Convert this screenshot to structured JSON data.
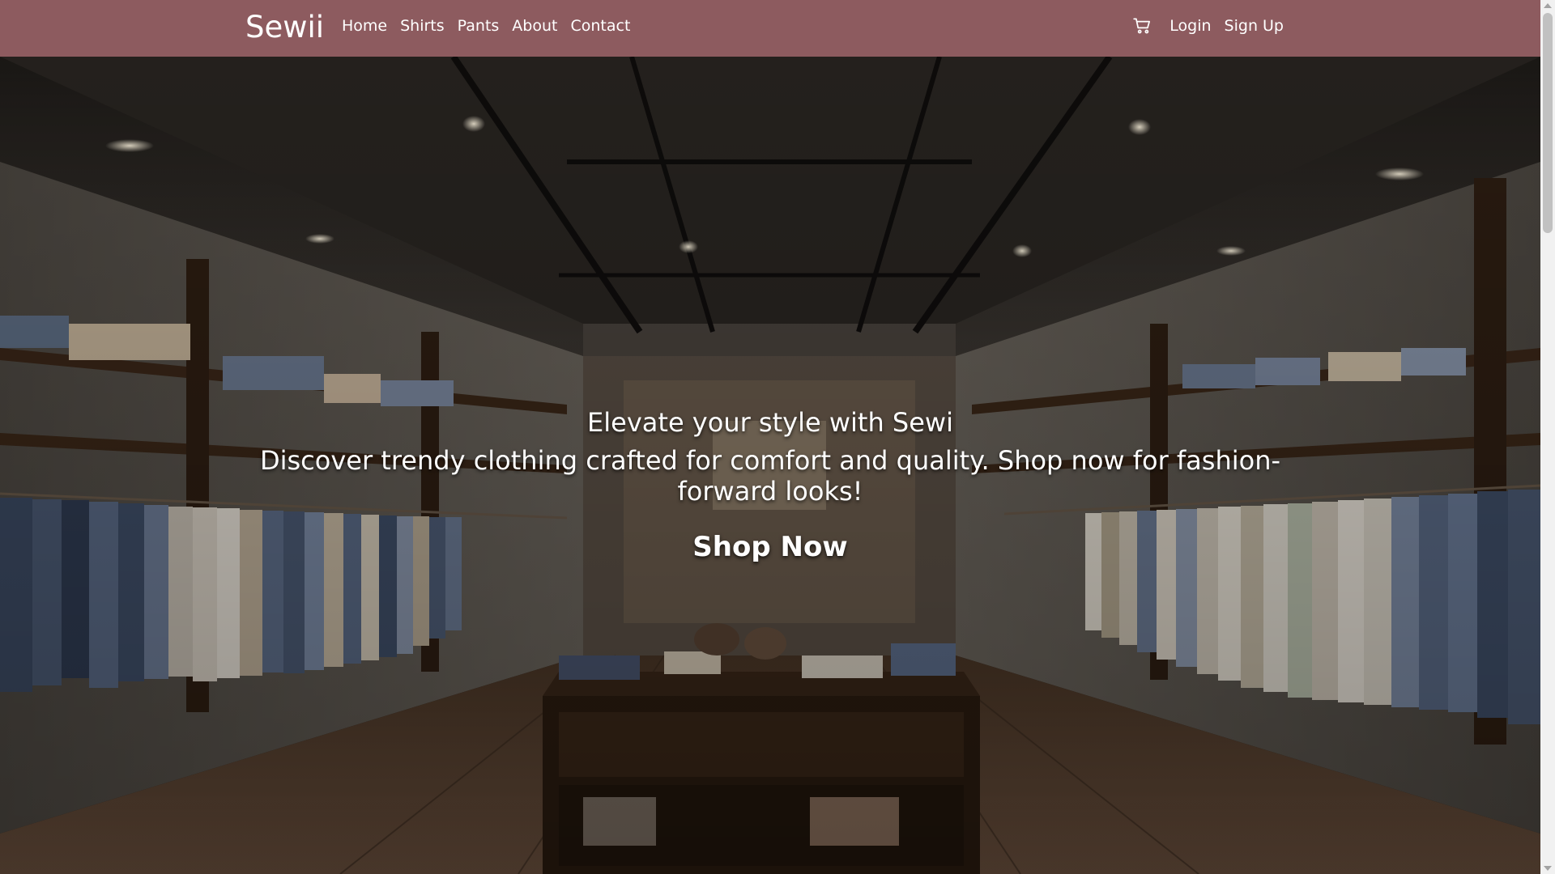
{
  "navbar": {
    "brand": "Sewii",
    "links": [
      "Home",
      "Shirts",
      "Pants",
      "About",
      "Contact"
    ],
    "cart_icon": "shopping-cart-icon",
    "login_label": "Login",
    "signup_label": "Sign Up",
    "background_color": "#8d5b5f"
  },
  "hero": {
    "headline": "Elevate your style with Sewi",
    "subheadline": "Discover trendy clothing crafted for comfort and quality. Shop now for fashion-forward looks!",
    "cta_label": "Shop Now",
    "background": "clothing-store-interior-photo"
  }
}
